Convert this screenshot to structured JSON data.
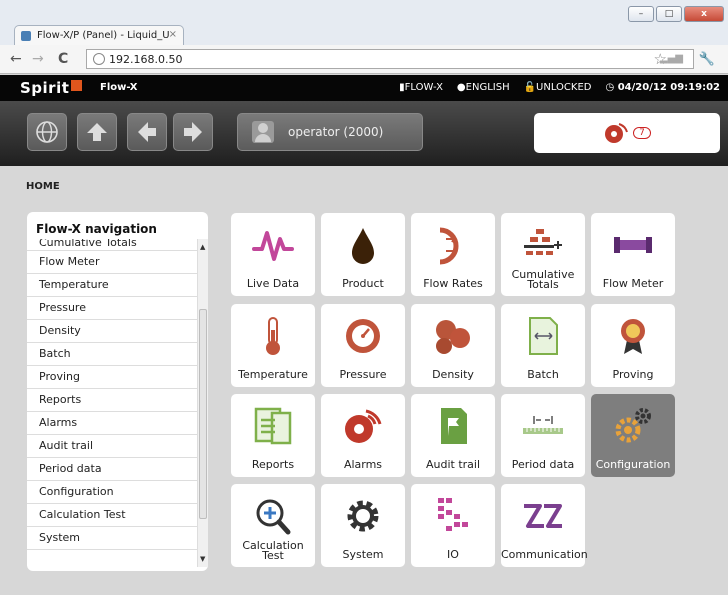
{
  "browser": {
    "tab_title": "Flow-X/P (Panel) - Liquid_U",
    "tab_close": "×",
    "url": "192.168.0.50",
    "window_controls": [
      "–",
      "□",
      "x"
    ]
  },
  "app": {
    "logo": "Spirit",
    "name": "Flow-X",
    "status": {
      "device": "FLOW-X",
      "language": "ENGLISH",
      "lock": "UNLOCKED",
      "datetime": "04/20/12 09:19:02"
    },
    "user": "operator (2000)",
    "alarm_count": "7"
  },
  "breadcrumb": "HOME",
  "sidebar": {
    "title": "Flow-X navigation",
    "items": [
      "Cumulative Totals",
      "Flow Meter",
      "Temperature",
      "Pressure",
      "Density",
      "Batch",
      "Proving",
      "Reports",
      "Alarms",
      "Audit trail",
      "Period data",
      "Configuration",
      "Calculation Test",
      "System"
    ]
  },
  "tiles": [
    {
      "label": "Live Data",
      "icon": "pulse-icon"
    },
    {
      "label": "Product",
      "icon": "drop-icon"
    },
    {
      "label": "Flow Rates",
      "icon": "flow-rates-icon"
    },
    {
      "label": "Cumulative Totals",
      "icon": "totals-icon"
    },
    {
      "label": "Flow Meter",
      "icon": "pipe-icon"
    },
    {
      "label": "Temperature",
      "icon": "thermometer-icon"
    },
    {
      "label": "Pressure",
      "icon": "gauge-icon"
    },
    {
      "label": "Density",
      "icon": "density-icon"
    },
    {
      "label": "Batch",
      "icon": "batch-icon"
    },
    {
      "label": "Proving",
      "icon": "medal-icon"
    },
    {
      "label": "Reports",
      "icon": "report-icon"
    },
    {
      "label": "Alarms",
      "icon": "alarm-bell-icon"
    },
    {
      "label": "Audit trail",
      "icon": "flag-doc-icon"
    },
    {
      "label": "Period data",
      "icon": "ruler-icon"
    },
    {
      "label": "Configuration",
      "icon": "gears-icon"
    },
    {
      "label": "Calculation Test",
      "icon": "magnifier-plus-icon"
    },
    {
      "label": "System",
      "icon": "gear-icon"
    },
    {
      "label": "IO",
      "icon": "io-icon"
    },
    {
      "label": "Communication",
      "icon": "communication-icon"
    }
  ],
  "colors": {
    "accent_pink": "#c2479a",
    "accent_copper": "#c0543b",
    "accent_green": "#7fb04a",
    "accent_purple": "#7b3f8f",
    "active_tile": "#7e7e7e"
  }
}
